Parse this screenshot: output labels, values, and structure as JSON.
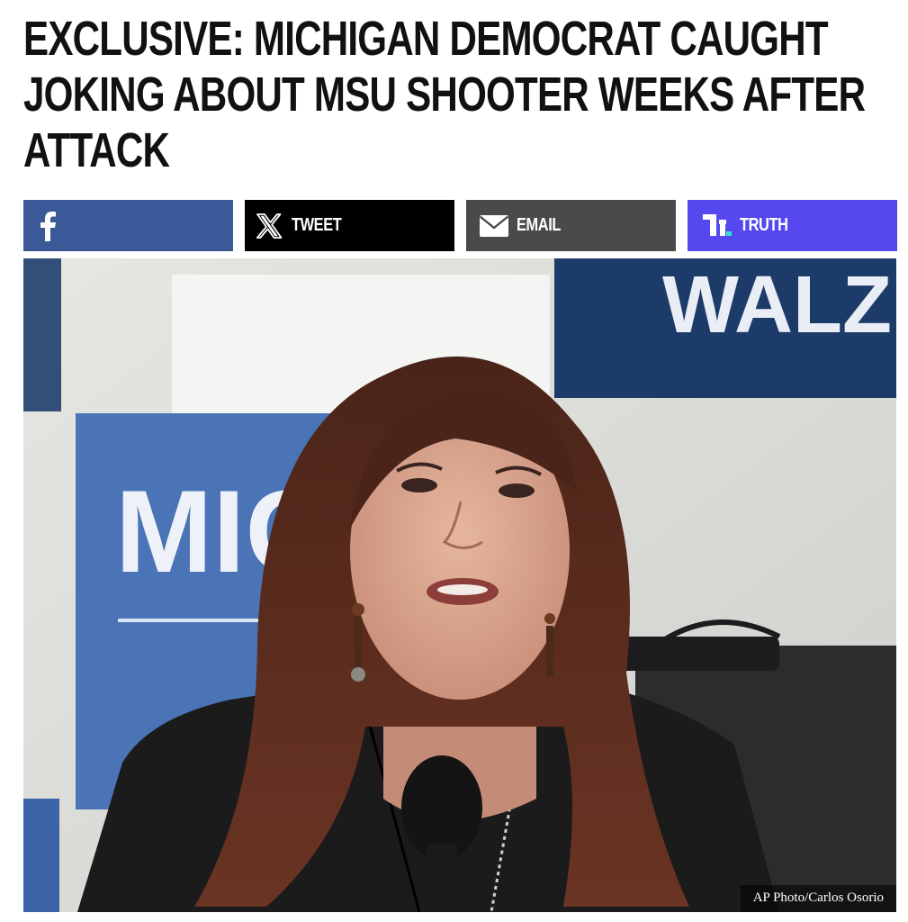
{
  "article": {
    "headline": "EXCLUSIVE: MICHIGAN DEMOCRAT CAUGHT JOKING ABOUT MSU SHOOTER WEEKS AFTER ATTACK"
  },
  "share": {
    "facebook": {
      "label": "",
      "icon": "facebook-icon",
      "color": "#3b5998"
    },
    "tweet": {
      "label": "TWEET",
      "icon": "x-logo-icon",
      "color": "#000000"
    },
    "email": {
      "label": "EMAIL",
      "icon": "envelope-icon",
      "color": "#4a4a4a"
    },
    "truth": {
      "label": "TRUTH",
      "icon": "truth-social-icon",
      "color": "#5448ee"
    }
  },
  "photo": {
    "sign_top_right": "WALZ",
    "sign_left": "MICH",
    "credit": "AP Photo/Carlos Osorio"
  }
}
